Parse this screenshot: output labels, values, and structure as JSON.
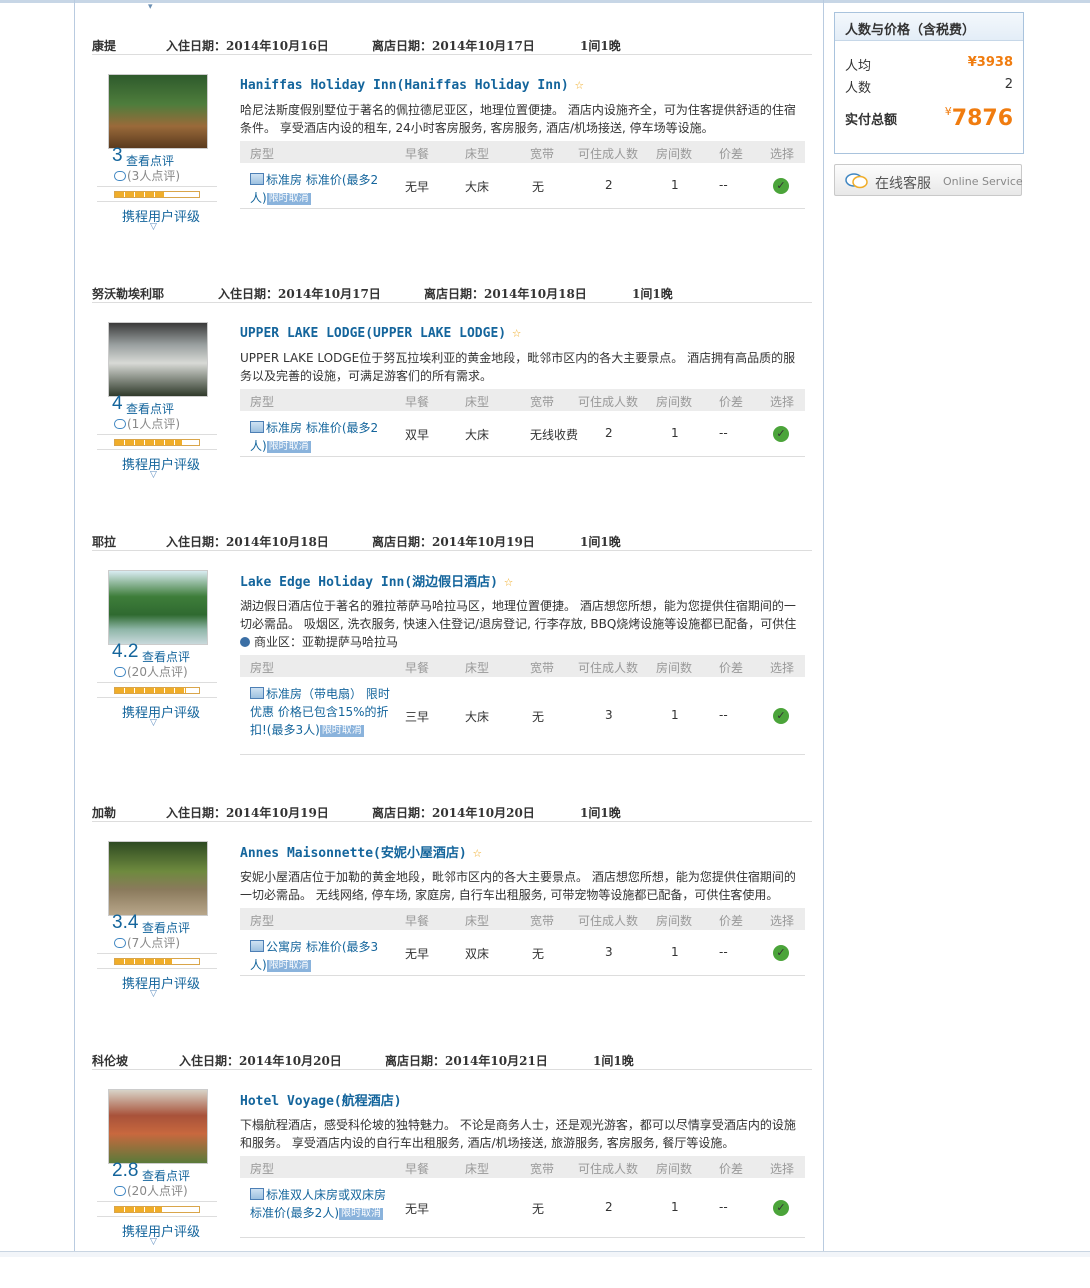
{
  "table_headers": [
    "房型",
    "早餐",
    "床型",
    "宽带",
    "可住成人数",
    "房间数",
    "价差",
    "选择"
  ],
  "rating_link_label": "携程用户评级",
  "review_link_label": "查看点评",
  "stays": [
    {
      "city": "康提",
      "checkin": "入住日期：2014年10月16日",
      "checkout": "离店日期：2014年10月17日",
      "nights": "1间1晚",
      "hotel_name": "Haniffas Holiday Inn(Haniffas Holiday Inn)",
      "starred": true,
      "desc": "哈尼法斯度假别墅位于著名的佩拉德尼亚区，地理位置便捷。 酒店内设施齐全，可为住客提供舒适的住宿条件。 享受酒店内设的租车, 24小时客房服务, 客房服务, 酒店/机场接送, 停车场等设施。",
      "biz_area": "",
      "score": "3",
      "review_count": "(3人点评)",
      "rating_fill": 0.6,
      "room": {
        "name": "标准房 标准价(最多2人)",
        "tag": "限时取消",
        "breakfast": "无早",
        "bed": "大床",
        "net": "无",
        "adults": "2",
        "rooms": "1",
        "diff": "--"
      }
    },
    {
      "city": "努沃勒埃利耶",
      "checkin": "入住日期：2014年10月17日",
      "checkout": "离店日期：2014年10月18日",
      "nights": "1间1晚",
      "hotel_name": "UPPER LAKE LODGE(UPPER LAKE LODGE)",
      "starred": true,
      "desc": "UPPER LAKE LODGE位于努瓦拉埃利亚的黄金地段，毗邻市区内的各大主要景点。 酒店拥有高品质的服务以及完善的设施，可满足游客们的所有需求。",
      "biz_area": "",
      "score": "4",
      "review_count": "(1人点评)",
      "rating_fill": 0.8,
      "room": {
        "name": "标准房 标准价(最多2人)",
        "tag": "限时取消",
        "breakfast": "双早",
        "bed": "大床",
        "net": "无线收费",
        "adults": "2",
        "rooms": "1",
        "diff": "--"
      }
    },
    {
      "city": "耶拉",
      "checkin": "入住日期：2014年10月18日",
      "checkout": "离店日期：2014年10月19日",
      "nights": "1间1晚",
      "hotel_name": "Lake Edge Holiday Inn(湖边假日酒店)",
      "starred": true,
      "desc": "湖边假日酒店位于著名的雅拉蒂萨马哈拉马区，地理位置便捷。 酒店想您所想，能为您提供住宿期间的一切必需品。 吸烟区, 洗衣服务, 快速入住登记/退房登记, 行李存放, BBQ烧烤设施等设施都已配备，可供住",
      "biz_area": "商业区：亚勒提萨马哈拉马",
      "score": "4.2",
      "review_count": "(20人点评)",
      "rating_fill": 0.84,
      "room": {
        "name": "标准房（带电扇） 限时优惠 价格已包含15%的折扣!(最多3人)",
        "tag": "限时取消",
        "breakfast": "三早",
        "bed": "大床",
        "net": "无",
        "adults": "3",
        "rooms": "1",
        "diff": "--"
      }
    },
    {
      "city": "加勒",
      "checkin": "入住日期：2014年10月19日",
      "checkout": "离店日期：2014年10月20日",
      "nights": "1间1晚",
      "hotel_name": "Annes Maisonnette(安妮小屋酒店)",
      "starred": true,
      "desc": "安妮小屋酒店位于加勒的黄金地段，毗邻市区内的各大主要景点。 酒店想您所想，能为您提供住宿期间的一切必需品。 无线网络, 停车场, 家庭房, 自行车出租服务, 可带宠物等设施都已配备，可供住客使用。",
      "biz_area": "",
      "score": "3.4",
      "review_count": "(7人点评)",
      "rating_fill": 0.68,
      "room": {
        "name": "公寓房 标准价(最多3人)",
        "tag": "限时取消",
        "breakfast": "无早",
        "bed": "双床",
        "net": "无",
        "adults": "3",
        "rooms": "1",
        "diff": "--"
      }
    },
    {
      "city": "科伦坡",
      "checkin": "入住日期：2014年10月20日",
      "checkout": "离店日期：2014年10月21日",
      "nights": "1间1晚",
      "hotel_name": "Hotel Voyage(航程酒店)",
      "starred": false,
      "desc": "下榻航程酒店，感受科伦坡的独特魅力。 不论是商务人士，还是观光游客，都可以尽情享受酒店内的设施和服务。 享受酒店内设的自行车出租服务, 酒店/机场接送, 旅游服务, 客房服务, 餐厅等设施。",
      "biz_area": "",
      "score": "2.8",
      "review_count": "(20人点评)",
      "rating_fill": 0.56,
      "room": {
        "name": "标准双人床房或双床房 标准价(最多2人)",
        "tag": "限时取消",
        "breakfast": "无早",
        "bed": "",
        "net": "无",
        "adults": "2",
        "rooms": "1",
        "diff": "--"
      }
    }
  ],
  "sidebar": {
    "title": "人数与价格（含税费）",
    "per_person_label": "人均",
    "per_person_value": "¥3938",
    "people_label": "人数",
    "people_value": "2",
    "total_label": "实付总额",
    "total_currency": "¥",
    "total_value": "7876",
    "service_cn": "在线客服",
    "service_en": "Online Service"
  }
}
